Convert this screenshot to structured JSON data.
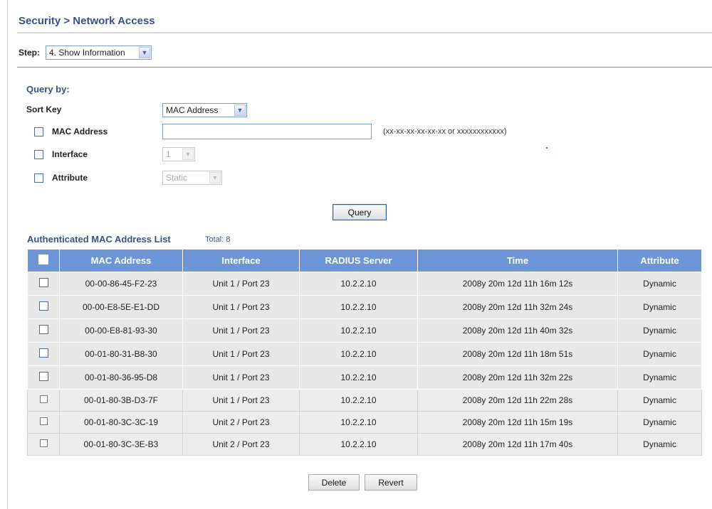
{
  "page": {
    "title": "Security > Network Access"
  },
  "step": {
    "label": "Step:",
    "selected": "4. Show Information"
  },
  "query": {
    "heading": "Query by:",
    "sort_key_label": "Sort Key",
    "sort_key_value": "MAC Address",
    "mac_address_label": "MAC Address",
    "mac_address_value": "",
    "mac_address_hint": "(xx-xx-xx-xx-xx-xx or xxxxxxxxxxxx)",
    "interface_label": "Interface",
    "interface_value": "1",
    "attribute_label": "Attribute",
    "attribute_value": "Static",
    "button_label": "Query"
  },
  "list": {
    "title": "Authenticated MAC Address List",
    "total": "Total: 8",
    "columns": [
      "MAC Address",
      "Interface",
      "RADIUS Server",
      "Time",
      "Attribute"
    ],
    "rows": [
      {
        "mac": "00-00-86-45-F2-23",
        "interface": "Unit 1 / Port 23",
        "radius": "10.2.2.10",
        "time": "2008y 20m 12d 11h 16m 12s",
        "attribute": "Dynamic"
      },
      {
        "mac": "00-00-E8-5E-E1-DD",
        "interface": "Unit 1 / Port 23",
        "radius": "10.2.2.10",
        "time": "2008y 20m 12d 11h 32m 24s",
        "attribute": "Dynamic"
      },
      {
        "mac": "00-00-E8-81-93-30",
        "interface": "Unit 1 / Port 23",
        "radius": "10.2.2.10",
        "time": "2008y 20m 12d 11h 40m 32s",
        "attribute": "Dynamic"
      },
      {
        "mac": "00-01-80-31-B8-30",
        "interface": "Unit 1 / Port 23",
        "radius": "10.2.2.10",
        "time": "2008y 20m 12d 11h 18m 51s",
        "attribute": "Dynamic"
      },
      {
        "mac": "00-01-80-36-95-D8",
        "interface": "Unit 1 / Port 23",
        "radius": "10.2.2.10",
        "time": "2008y 20m 12d 11h 32m 22s",
        "attribute": "Dynamic"
      },
      {
        "mac": "00-01-80-3B-D3-7F",
        "interface": "Unit 1 / Port 23",
        "radius": "10.2.2.10",
        "time": "2008y 20m 12d 11h 22m 28s",
        "attribute": "Dynamic"
      },
      {
        "mac": "00-01-80-3C-3C-19",
        "interface": "Unit 2 / Port 23",
        "radius": "10.2.2.10",
        "time": "2008y 20m 12d 11h 15m 19s",
        "attribute": "Dynamic"
      },
      {
        "mac": "00-01-80-3C-3E-B3",
        "interface": "Unit 2 / Port 23",
        "radius": "10.2.2.10",
        "time": "2008y 20m 12d 11h 17m 40s",
        "attribute": "Dynamic"
      }
    ]
  },
  "actions": {
    "delete_label": "Delete",
    "revert_label": "Revert"
  },
  "icons": {
    "dropdown": "chevron-down-icon"
  },
  "colors": {
    "header_bg": "#6c96d8",
    "title_text": "#3a4f86"
  }
}
